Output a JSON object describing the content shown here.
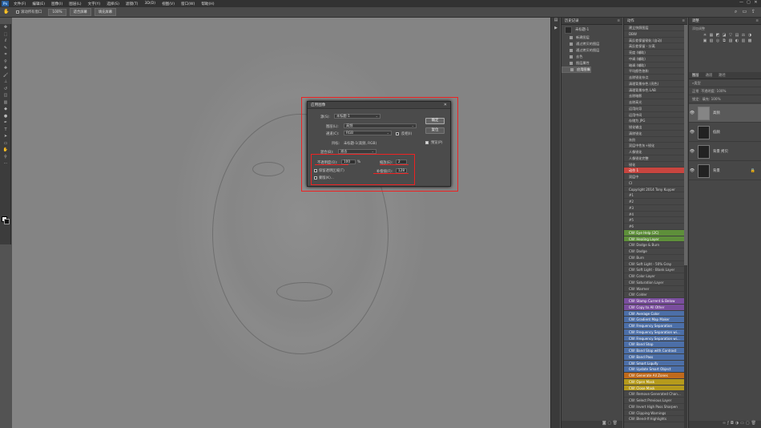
{
  "menubar": {
    "logo": "Ps",
    "items": [
      "文件(F)",
      "编辑(E)",
      "图像(I)",
      "图层(L)",
      "文字(Y)",
      "选择(S)",
      "滤镜(T)",
      "3D(D)",
      "视图(V)",
      "窗口(W)",
      "帮助(H)"
    ],
    "min": "—",
    "max": "▢",
    "close": "✕"
  },
  "options": {
    "tool_icon": "hand-icon",
    "scroll_all": "滚动所有窗口",
    "zoom": "100%",
    "fit_screen": "适合屏幕",
    "fill_screen": "填充屏幕"
  },
  "dialog": {
    "title": "应用图像",
    "close": "✕",
    "source_label": "源(S):",
    "source_value": "未标题-1",
    "layer_label": "图层(L):",
    "layer_value": "高频",
    "channel_label": "通道(C):",
    "channel_value": "RGB",
    "invert_label": "反相(I)",
    "target_label": "目标:",
    "target_value": "未标题-1(高频, RGB)",
    "blending_label": "混合(B):",
    "blending_value": "减去",
    "opacity_label": "不透明度(O):",
    "opacity_value": "100",
    "opacity_unit": "%",
    "scale_label": "缩放(E):",
    "scale_value": "2",
    "preserve_label": "保留透明区域(T)",
    "offset_label": "补偿值(F):",
    "offset_value": "128",
    "mask_label": "蒙版(K)...",
    "ok": "确定",
    "reset": "复位",
    "preview_label": "预览(P)"
  },
  "history": {
    "title": "历史记录",
    "snapshot": "未标题-1",
    "states": [
      "新建图层",
      "通过拷贝的图层",
      "通过拷贝的图层",
      "去色",
      "图层属性",
      "应用图像"
    ]
  },
  "actions": {
    "title": "动作",
    "items": [
      {
        "label": "建立快照图层",
        "color": ""
      },
      {
        "label": "DBW",
        "color": ""
      },
      {
        "label": "高反差保留锐化 (自动)",
        "color": ""
      },
      {
        "label": "高反差保留 - 分离",
        "color": ""
      },
      {
        "label": "亮度 (辅助)",
        "color": ""
      },
      {
        "label": "中调 (辅助)",
        "color": ""
      },
      {
        "label": "暗调 (辅助)",
        "color": ""
      },
      {
        "label": "平均颜色饱和",
        "color": ""
      },
      {
        "label": "去除锐化杂点",
        "color": ""
      },
      {
        "label": "清理背景杂色 (亮色)",
        "color": ""
      },
      {
        "label": "清理背景杂色 LAB",
        "color": ""
      },
      {
        "label": "去除暗影",
        "color": ""
      },
      {
        "label": "去除高光",
        "color": ""
      },
      {
        "label": "运用向导",
        "color": ""
      },
      {
        "label": "运用中间",
        "color": ""
      },
      {
        "label": "存储为 JPG",
        "color": ""
      },
      {
        "label": "锐化输出",
        "color": ""
      },
      {
        "label": "清除锐化",
        "color": ""
      },
      {
        "label": "灰阶",
        "color": ""
      },
      {
        "label": "双层中性灰+锐化",
        "color": ""
      },
      {
        "label": "人像锐化",
        "color": ""
      },
      {
        "label": "人像锐化完整",
        "color": ""
      },
      {
        "label": "锐化",
        "color": ""
      },
      {
        "label": "动作 1",
        "color": "#c8453f"
      },
      {
        "label": "双层中",
        "color": ""
      },
      {
        "label": "CI",
        "color": ""
      },
      {
        "label": "Copyright 2014 Tony Kuyper",
        "color": ""
      },
      {
        "label": "#1",
        "color": ""
      },
      {
        "label": "#2",
        "color": ""
      },
      {
        "label": "#3",
        "color": ""
      },
      {
        "label": "#4",
        "color": ""
      },
      {
        "label": "#5",
        "color": ""
      },
      {
        "label": "#6",
        "color": ""
      },
      {
        "label": "CW: Eye Help (2C)",
        "color": "#5e8f3a"
      },
      {
        "label": "CW: Healing Layer",
        "color": "#5e8f3a"
      },
      {
        "label": "CW: Dodge & Burn",
        "color": ""
      },
      {
        "label": "CW: Dodge",
        "color": ""
      },
      {
        "label": "CW: Burn",
        "color": ""
      },
      {
        "label": "CW: Soft Light - 50% Gray",
        "color": ""
      },
      {
        "label": "CW: Soft Light - Blank Layer",
        "color": ""
      },
      {
        "label": "CW: Color Layer",
        "color": ""
      },
      {
        "label": "CW: Saturation Layer",
        "color": ""
      },
      {
        "label": "CW: Warmer",
        "color": ""
      },
      {
        "label": "CW: Colder",
        "color": ""
      },
      {
        "label": "CW: Stamp Current & Below",
        "color": "#7a4e9e"
      },
      {
        "label": "CW: Copy to All Other",
        "color": "#7a4e9e"
      },
      {
        "label": "CW: Average Color",
        "color": "#4c6fa8"
      },
      {
        "label": "CW: Gradient Map Maker",
        "color": "#4c6fa8"
      },
      {
        "label": "CW: Frequency Separation",
        "color": "#4c6fa8"
      },
      {
        "label": "CW: Frequency Separation wi...",
        "color": "#4c6fa8"
      },
      {
        "label": "CW: Frequency Separation wi...",
        "color": "#4c6fa8"
      },
      {
        "label": "CW: Band Stop",
        "color": "#4c6fa8"
      },
      {
        "label": "CW: Band Stop with Contrast",
        "color": "#4c6fa8"
      },
      {
        "label": "CW: Band Pass",
        "color": "#4c6fa8"
      },
      {
        "label": "CW: Smart Liquify",
        "color": "#4c6fa8"
      },
      {
        "label": "CW: Update Smart Object",
        "color": "#4c6fa8"
      },
      {
        "label": "CW: Generate All Zones",
        "color": "#c06a1c"
      },
      {
        "label": "CW: Open Mask",
        "color": "#b59a1c"
      },
      {
        "label": "CW: Close Mask",
        "color": "#b59a1c"
      },
      {
        "label": "CW: Remove Generated Chan...",
        "color": ""
      },
      {
        "label": "CW: Select Previous Layer",
        "color": ""
      },
      {
        "label": "CW: Invert High Pass Sharpen",
        "color": ""
      },
      {
        "label": "CW: Clipping Warnings",
        "color": ""
      },
      {
        "label": "CW: Blend-If Highlights",
        "color": ""
      }
    ]
  },
  "adjustments": {
    "title": "调整",
    "subtitle": "添加调整",
    "icons": [
      "☀",
      "▦",
      "◩",
      "◪",
      "▽",
      "▤",
      "⚖",
      "◑",
      "▣",
      "▧",
      "◎",
      "⧉",
      "▨",
      "◐",
      "▥",
      "▩"
    ]
  },
  "layers": {
    "tabs": [
      "图层",
      "通道",
      "路径"
    ],
    "kind_label": "类型",
    "blend_mode": "正常",
    "opacity_label": "不透明度: 100%",
    "lock_label": "锁定:",
    "fill_label": "填充: 100%",
    "items": [
      {
        "name": "高频",
        "thumb": "gray",
        "selected": true
      },
      {
        "name": "低频",
        "thumb": "photo",
        "selected": false
      },
      {
        "name": "背景 拷贝",
        "thumb": "photo",
        "selected": false
      },
      {
        "name": "背景",
        "thumb": "photo",
        "selected": false,
        "locked": true
      }
    ]
  }
}
